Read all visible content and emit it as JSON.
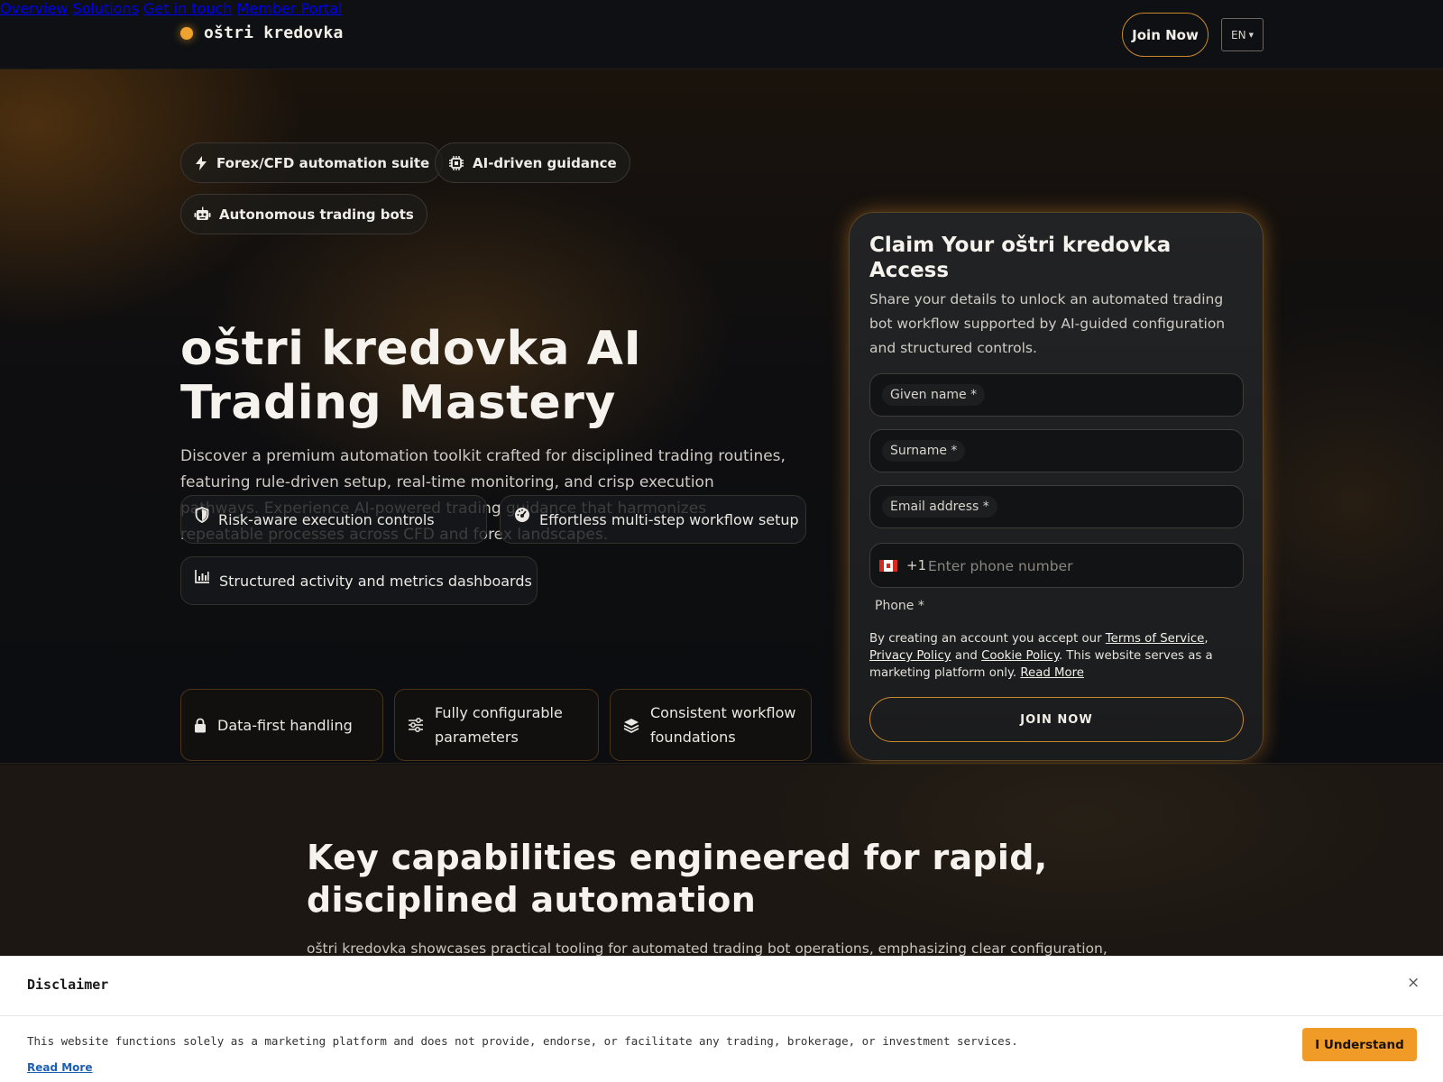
{
  "header": {
    "brand": "oštri kredovka",
    "nav": [
      "Overview",
      "Solutions",
      "Get in touch",
      "Member Portal"
    ],
    "join_label": "Join Now",
    "lang": "EN"
  },
  "hero": {
    "pills": [
      "Forex/CFD automation suite",
      "AI-driven guidance",
      "Autonomous trading bots"
    ],
    "title": "oštri kredovka AI Trading Mastery",
    "description": "Discover a premium automation toolkit crafted for disciplined trading routines, featuring rule-driven setup, real-time monitoring, and crisp execution pathways. Experience AI-powered trading guidance that harmonizes repeatable processes across CFD and forex landscapes.",
    "features": [
      "Risk-aware execution controls",
      "Effortless multi-step workflow setup",
      "Structured activity and metrics dashboards"
    ],
    "boxes": [
      "Data-first handling",
      "Fully configurable parameters",
      "Consistent workflow foundations"
    ]
  },
  "form": {
    "title": "Claim Your oštri kredovka Access",
    "description": "Share your details to unlock an automated trading bot workflow supported by AI-guided configuration and structured controls.",
    "given_name": "Given name *",
    "surname": "Surname *",
    "email": "Email address *",
    "dial_code": "+1",
    "phone_placeholder": "Enter phone number",
    "phone_label": "Phone *",
    "legal_prefix": "By creating an account you accept our ",
    "terms": "Terms of Service",
    "privacy": "Privacy Policy",
    "and": " and ",
    "cookie": "Cookie Policy",
    "legal_suffix": ". This website serves as a marketing platform only. ",
    "read_more": "Read More",
    "submit": "JOIN NOW"
  },
  "capabilities": {
    "title": "Key capabilities engineered for rapid, disciplined automation",
    "description": "oštri kredovka showcases practical tooling for automated trading bot operations, emphasizing clear configuration,"
  },
  "disclaimer": {
    "title": "Disclaimer",
    "close": "×",
    "text": "This website functions solely as a marketing platform and does not provide, endorse, or facilitate any trading, brokerage, or investment services.",
    "read_more": "Read More",
    "button": "I Understand"
  },
  "colors": {
    "accent": "#f0a22e",
    "button_orange": "#f09a28",
    "page_bg": "#0d0f12"
  },
  "icons": {
    "pill_1": "bolt-icon",
    "pill_2": "chip-icon",
    "pill_3": "robot-icon",
    "feature_1": "shield-icon",
    "feature_2": "gauge-icon",
    "feature_3": "bar-chart-icon",
    "box_1": "lock-icon",
    "box_2": "sliders-icon",
    "box_3": "layers-icon"
  }
}
